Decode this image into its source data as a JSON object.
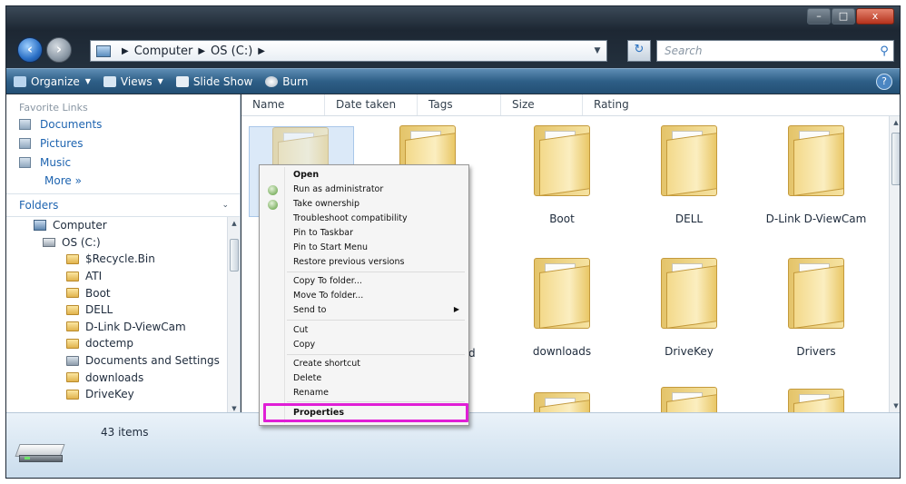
{
  "window": {
    "controls": [
      "–",
      "□",
      "x"
    ]
  },
  "address": {
    "path": [
      "Computer",
      "OS (C:)"
    ],
    "search_placeholder": "Search"
  },
  "toolbar": {
    "organize": "Organize",
    "views": "Views",
    "slideshow": "Slide Show",
    "burn": "Burn",
    "help": "?"
  },
  "nav": {
    "favorites_header": "Favorite Links",
    "favorites": [
      "Documents",
      "Pictures",
      "Music"
    ],
    "more": "More »",
    "folders_header": "Folders",
    "tree": [
      "Computer",
      "OS (C:)",
      "$Recycle.Bin",
      "ATI",
      "Boot",
      "DELL",
      "D-Link D-ViewCam",
      "doctemp",
      "Documents and Settings",
      "downloads",
      "DriveKey"
    ]
  },
  "columns": [
    "Name",
    "Date taken",
    "Tags",
    "Size",
    "Rating"
  ],
  "items_row1": [
    "",
    "",
    "Boot",
    "DELL",
    "D-Link D-ViewCam"
  ],
  "items_row2": [
    "d",
    "downloads",
    "DriveKey",
    "Drivers"
  ],
  "status": {
    "count": "43 items"
  },
  "context_menu": {
    "open": "Open",
    "run_as_admin": "Run as administrator",
    "take_ownership": "Take ownership",
    "troubleshoot": "Troubleshoot compatibility",
    "pin_taskbar": "Pin to Taskbar",
    "pin_start": "Pin to Start Menu",
    "restore": "Restore previous versions",
    "copy_to": "Copy To folder...",
    "move_to": "Move To folder...",
    "send_to": "Send to",
    "cut": "Cut",
    "copy": "Copy",
    "create_shortcut": "Create shortcut",
    "delete": "Delete",
    "rename": "Rename",
    "properties": "Properties"
  },
  "colors": {
    "highlight": "#e01fd6",
    "toolbar": "#2e5f87",
    "link": "#1e64b0"
  }
}
